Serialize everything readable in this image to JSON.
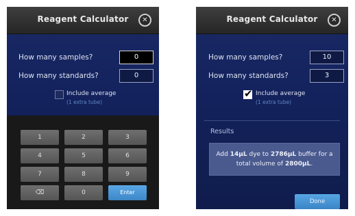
{
  "left": {
    "title": "Reagent Calculator",
    "close_icon": "close-circle-icon",
    "samples_label": "How many samples?",
    "samples_value": "0",
    "standards_label": "How many standards?",
    "standards_value": "0",
    "include_average_label": "Include average",
    "include_average_sub": "(1 extra tube)",
    "include_average_checked": false,
    "keys": [
      "1",
      "2",
      "3",
      "4",
      "5",
      "6",
      "7",
      "8",
      "9",
      "⌫",
      "0",
      "Enter"
    ]
  },
  "right": {
    "title": "Reagent Calculator",
    "close_icon": "close-circle-icon",
    "samples_label": "How many samples?",
    "samples_value": "10",
    "standards_label": "How many standards?",
    "standards_value": "3",
    "include_average_label": "Include average",
    "include_average_sub": "(1 extra tube)",
    "include_average_checked": true,
    "results_label": "Results",
    "results": {
      "prefix": "Add ",
      "dye": "14µL",
      "mid": " dye to ",
      "buffer": "2786µL",
      "mid2": " buffer for a total volume of ",
      "total": "2800µL",
      "suffix": "."
    },
    "done_label": "Done"
  },
  "colors": {
    "screen_bg": "#13225c",
    "titlebar": "#2f2f2f",
    "keypad_key": "#606060",
    "enter_key": "#4a97d7",
    "accent_blue": "#4a97d7",
    "results_box": "#4a5a8e"
  }
}
